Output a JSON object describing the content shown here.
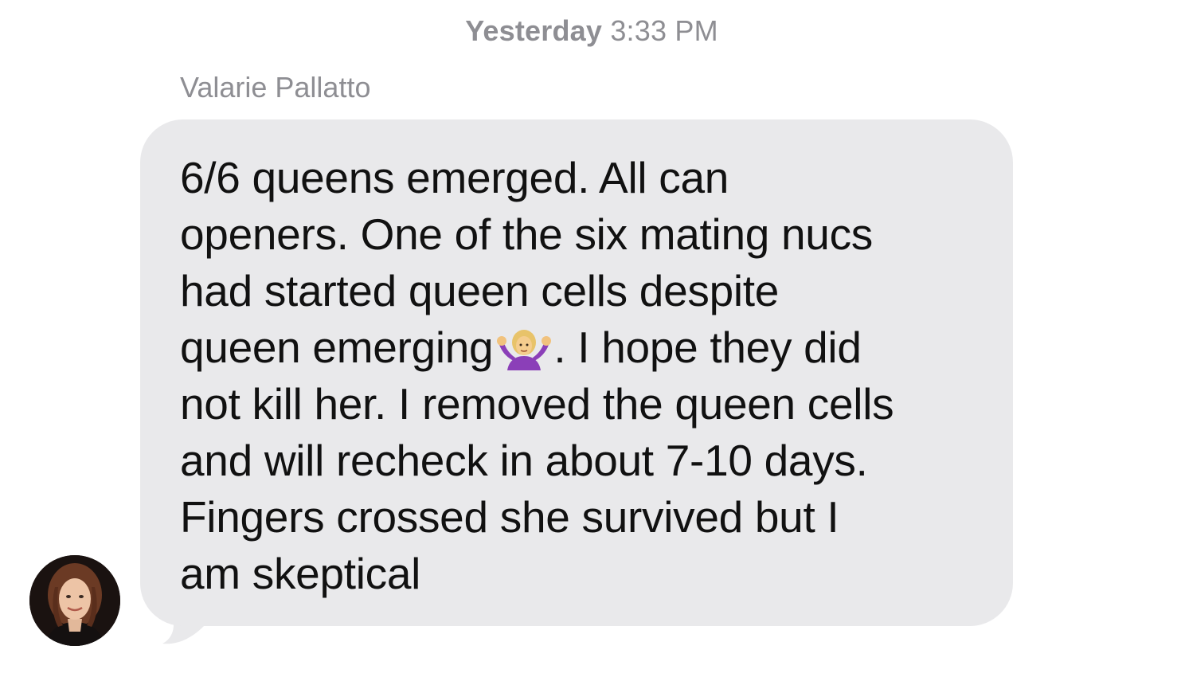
{
  "conversation": {
    "timestamp_day": "Yesterday",
    "timestamp_time": "3:33 PM",
    "sender_name": "Valarie Pallatto"
  },
  "message": {
    "lines": [
      "6/6 queens emerged. All can",
      "openers. One of the six mating nucs",
      "had started queen cells despite",
      "queen emerging",
      ". I hope they did",
      "not kill her. I removed the queen cells",
      "and will recheck in about 7-10 days.",
      "Fingers crossed she survived but I",
      "am skeptical"
    ],
    "emoji": "person-shrugging-emoji"
  },
  "colors": {
    "bubble": "#e9e9eb",
    "meta_text": "#8e8e93",
    "message_text": "#111111"
  }
}
